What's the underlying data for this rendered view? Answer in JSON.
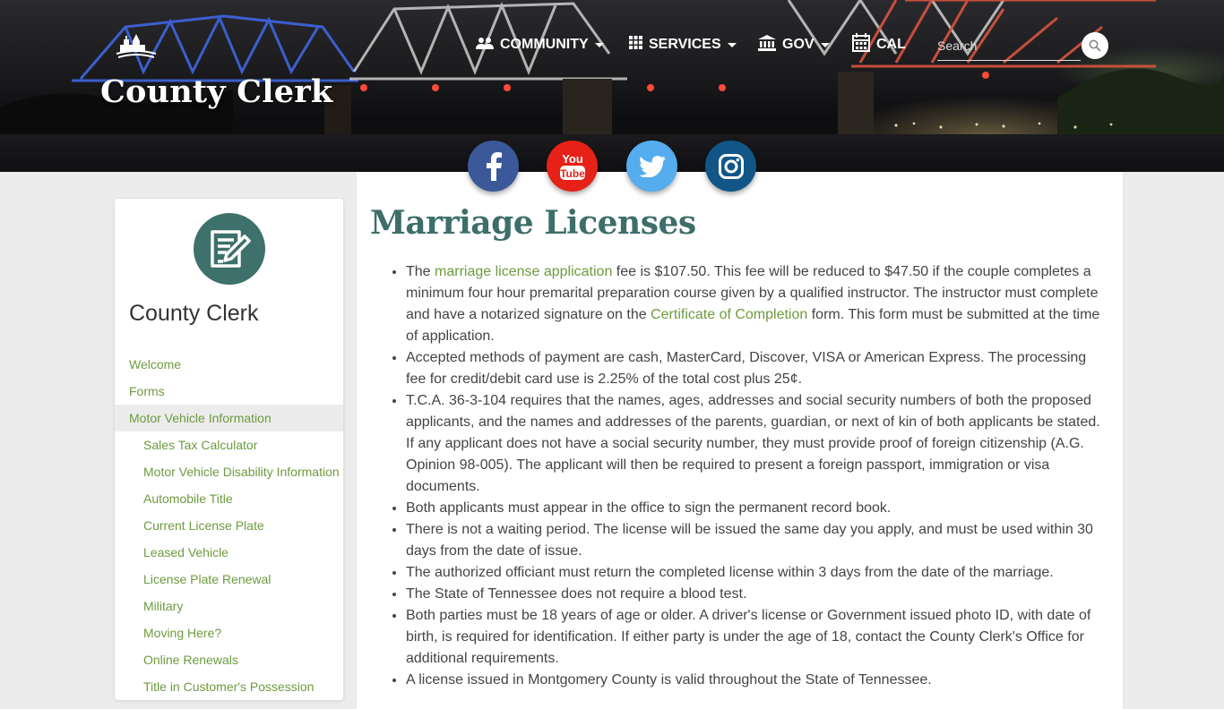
{
  "header": {
    "site_title": "County Clerk",
    "search_placeholder": "Search",
    "nav": [
      {
        "label": "COMMUNITY",
        "icon": "people-icon"
      },
      {
        "label": "SERVICES",
        "icon": "grid-icon"
      },
      {
        "label": "GOV",
        "icon": "government-building-icon"
      },
      {
        "label": "CAL",
        "icon": "calendar-icon"
      }
    ]
  },
  "social": [
    "facebook-icon",
    "youtube-icon",
    "twitter-icon",
    "instagram-icon"
  ],
  "social_labels": {
    "youtube_top": "You",
    "youtube_bottom": "Tube"
  },
  "sidebar": {
    "title": "County Clerk",
    "items": [
      {
        "label": "Welcome"
      },
      {
        "label": "Forms"
      },
      {
        "label": "Motor Vehicle Information",
        "active": true
      },
      {
        "label": "Sales Tax Calculator"
      },
      {
        "label": "Motor Vehicle Disability Information"
      },
      {
        "label": "Automobile Title"
      },
      {
        "label": "Current License Plate"
      },
      {
        "label": "Leased Vehicle"
      },
      {
        "label": "License Plate Renewal"
      },
      {
        "label": "Military"
      },
      {
        "label": "Moving Here?"
      },
      {
        "label": "Online Renewals"
      },
      {
        "label": "Title in Customer's Possession"
      }
    ]
  },
  "main": {
    "title": "Marriage Licenses",
    "bullets": [
      {
        "p1": "The ",
        "link1": "marriage license application",
        "p2": " fee is $107.50. This fee will be reduced to $47.50 if the couple completes a minimum four hour premarital preparation course given by a qualified instructor. The instructor must complete and have a notarized signature on the ",
        "link2": "Certificate of Completion",
        "p3": " form. This form must be submitted at the time of application."
      },
      {
        "text": "Accepted methods of payment are cash, MasterCard, Discover, VISA or American Express. The processing fee for credit/debit card use is 2.25% of the total cost plus 25¢."
      },
      {
        "text": "T.C.A. 36-3-104 requires that the names, ages, addresses and social security numbers of both the proposed applicants, and the names and addresses of the parents, guardian, or next of kin of both applicants be stated. If any applicant does not have a social security number, they must provide proof of foreign citizenship (A.G. Opinion 98-005). The applicant will then be required to present a foreign passport, immigration or visa documents."
      },
      {
        "text": "Both applicants must appear in the office to sign the permanent record book."
      },
      {
        "text": "There is not a waiting period. The license will be issued the same day you apply, and must be used within 30 days from the date of issue."
      },
      {
        "text": "The authorized officiant must return the completed license within 3 days from the date of the marriage."
      },
      {
        "text": "The State of Tennessee does not require a blood test."
      },
      {
        "text": "Both parties must be 18 years of age or older. A driver's license or Government issued photo ID, with date of birth, is required for identification. If either party is under the age of 18, contact the County Clerk's Office for additional requirements."
      },
      {
        "text": "A license issued in Montgomery County is valid throughout the State of Tennessee."
      }
    ]
  },
  "colors": {
    "accent_green": "#6d9b3f",
    "title_teal": "#3d6e6a",
    "facebook": "#3b5998",
    "youtube": "#e62117",
    "twitter": "#55acee",
    "instagram": "#125688"
  }
}
